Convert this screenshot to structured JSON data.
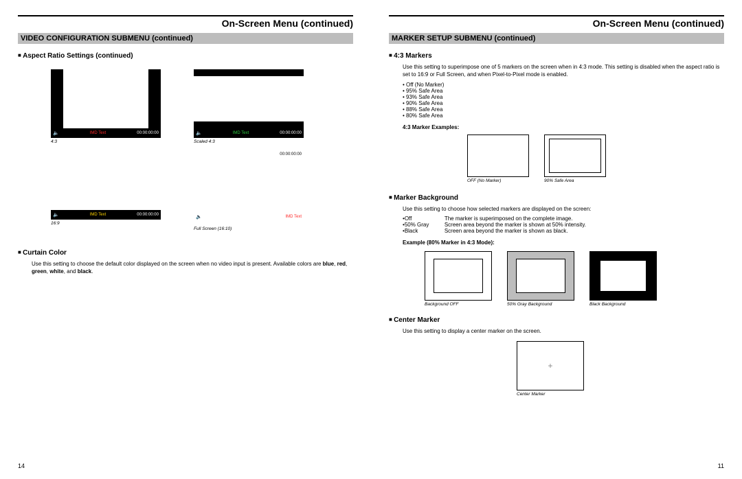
{
  "left": {
    "page_title": "On-Screen Menu (continued)",
    "section": "VIDEO CONFIGURATION SUBMENU (continued)",
    "aspect_head": "Aspect Ratio Settings (continued)",
    "screens": {
      "s1": {
        "imd": "IMD Text",
        "time": "00:00:00:00",
        "caption": "4:3"
      },
      "s2": {
        "imd": "IMD Text",
        "time": "00:00:00:00",
        "caption": "Scaled 4:3"
      },
      "s3": {
        "imd": "IMD Text",
        "time": "00:00:00:00",
        "caption": "16:9"
      },
      "s4": {
        "imd": "IMD Text",
        "time": "00:00:00:00",
        "caption": "Full Screen (16:10)"
      }
    },
    "curtain_head": "Curtain Color",
    "curtain_text_a": "Use this setting to choose the default color displayed on the screen when no video input is present. Available colors are ",
    "curtain_text_b": "blue",
    "curtain_text_c": ", ",
    "curtain_text_d": "red",
    "curtain_text_e": ", ",
    "curtain_text_f": "green",
    "curtain_text_g": ", ",
    "curtain_text_h": "white",
    "curtain_text_i": ", and ",
    "curtain_text_j": "black",
    "curtain_text_k": ".",
    "page_num": "14"
  },
  "right": {
    "page_title": "On-Screen Menu (continued)",
    "section": "MARKER SETUP SUBMENU (continued)",
    "markers_head": "4:3 Markers",
    "markers_text": "Use this setting to superimpose one of 5 markers on the screen when in 4:3 mode. This setting is disabled when the aspect ratio is set to 16:9 or Full Screen, and when Pixel-to-Pixel mode is enabled.",
    "markers_bullets": {
      "b0": "Off (No Marker)",
      "b1": "95% Safe Area",
      "b2": "93% Safe Area",
      "b3": "90% Safe Area",
      "b4": "88% Safe Area",
      "b5": "80% Safe Area"
    },
    "markers_examples_label": "4:3 Marker Examples:",
    "marker_caption_off": "OFF (No Marker)",
    "marker_caption_90": "90% Safe Area",
    "bg_head": "Marker Background",
    "bg_text": "Use this setting to choose how selected markers are displayed on the screen:",
    "bg_defs": {
      "k0": "Off",
      "v0": "The marker is superimposed on the complete image.",
      "k1": "50% Gray",
      "v1": "Screen area beyond the marker is shown at 50% intensity.",
      "k2": "Black",
      "v2": "Screen area beyond the marker is shown as black."
    },
    "ex80_label": "Example (80% Marker in 4:3 Mode):",
    "ex80_captions": {
      "c0": "Background OFF",
      "c1": "50% Gray Background",
      "c2": "Black Background"
    },
    "center_head": "Center Marker",
    "center_text": "Use this setting to display a center marker on the screen.",
    "center_caption": "Center Marker",
    "page_num": "11"
  }
}
